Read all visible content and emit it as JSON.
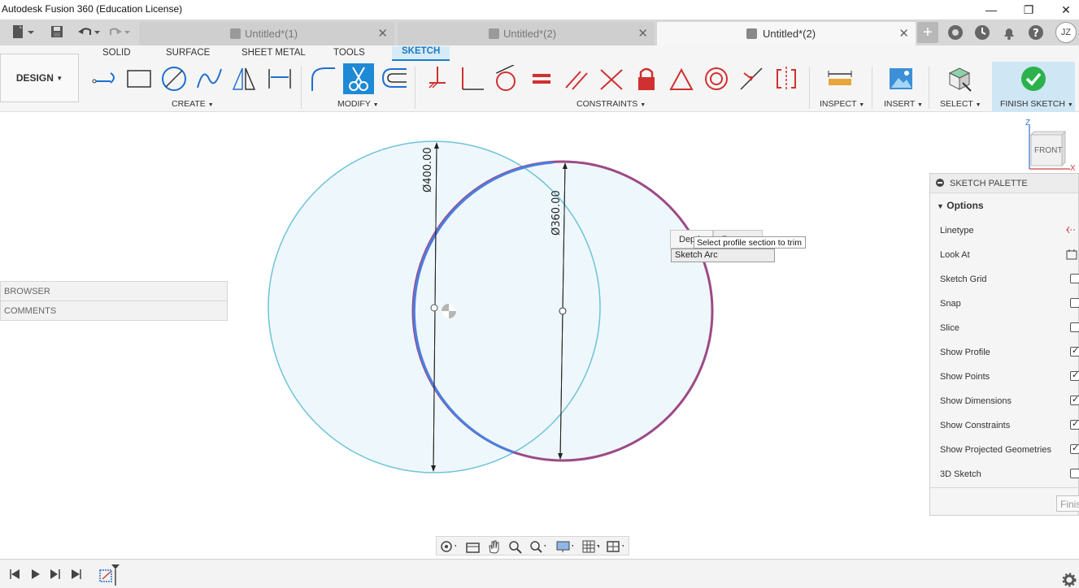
{
  "window": {
    "title": "Autodesk Fusion 360 (Education License)",
    "user_initials": "JZ"
  },
  "tabs": [
    {
      "label": "Untitled*(1)"
    },
    {
      "label": "Untitled*(2)"
    },
    {
      "label": "Untitled*(2)"
    }
  ],
  "ribbon": {
    "workspace": "DESIGN",
    "tabs": [
      "SOLID",
      "SURFACE",
      "SHEET METAL",
      "TOOLS",
      "SKETCH"
    ],
    "groups": {
      "create": "CREATE",
      "modify": "MODIFY",
      "constraints": "CONSTRAINTS",
      "inspect": "INSPECT",
      "insert": "INSERT",
      "select": "SELECT",
      "finish": "FINISH SKETCH"
    }
  },
  "panels": {
    "browser": "BROWSER",
    "comments": "COMMENTS"
  },
  "dimensions": {
    "large": "Ø400.00",
    "small": "Ø360.00"
  },
  "context": {
    "tab_depth": "Depth",
    "tab_parents": "Parents",
    "tooltip": "Select profile section to trim",
    "selection": "Sketch Arc"
  },
  "viewcube": {
    "face": "FRONT",
    "z": "Z",
    "x": "X"
  },
  "palette": {
    "title": "SKETCH PALETTE",
    "section": "Options",
    "options": [
      {
        "label": "Linetype",
        "kind": "icon"
      },
      {
        "label": "Look At",
        "kind": "icon"
      },
      {
        "label": "Sketch Grid",
        "checked": false
      },
      {
        "label": "Snap",
        "checked": false
      },
      {
        "label": "Slice",
        "checked": false
      },
      {
        "label": "Show Profile",
        "checked": true
      },
      {
        "label": "Show Points",
        "checked": true
      },
      {
        "label": "Show Dimensions",
        "checked": true
      },
      {
        "label": "Show Constraints",
        "checked": true
      },
      {
        "label": "Show Projected Geometries",
        "checked": true
      },
      {
        "label": "3D Sketch",
        "checked": false
      }
    ],
    "finish_label": "Finish Sketch"
  },
  "colors": {
    "accent": "#1e8ad6",
    "circle_large": "#6ec3d8",
    "arc_blue": "#4a7fe0",
    "arc_purple": "#9c4a86",
    "profile_fill": "#eef7fb",
    "finish_green": "#2bb24c"
  }
}
